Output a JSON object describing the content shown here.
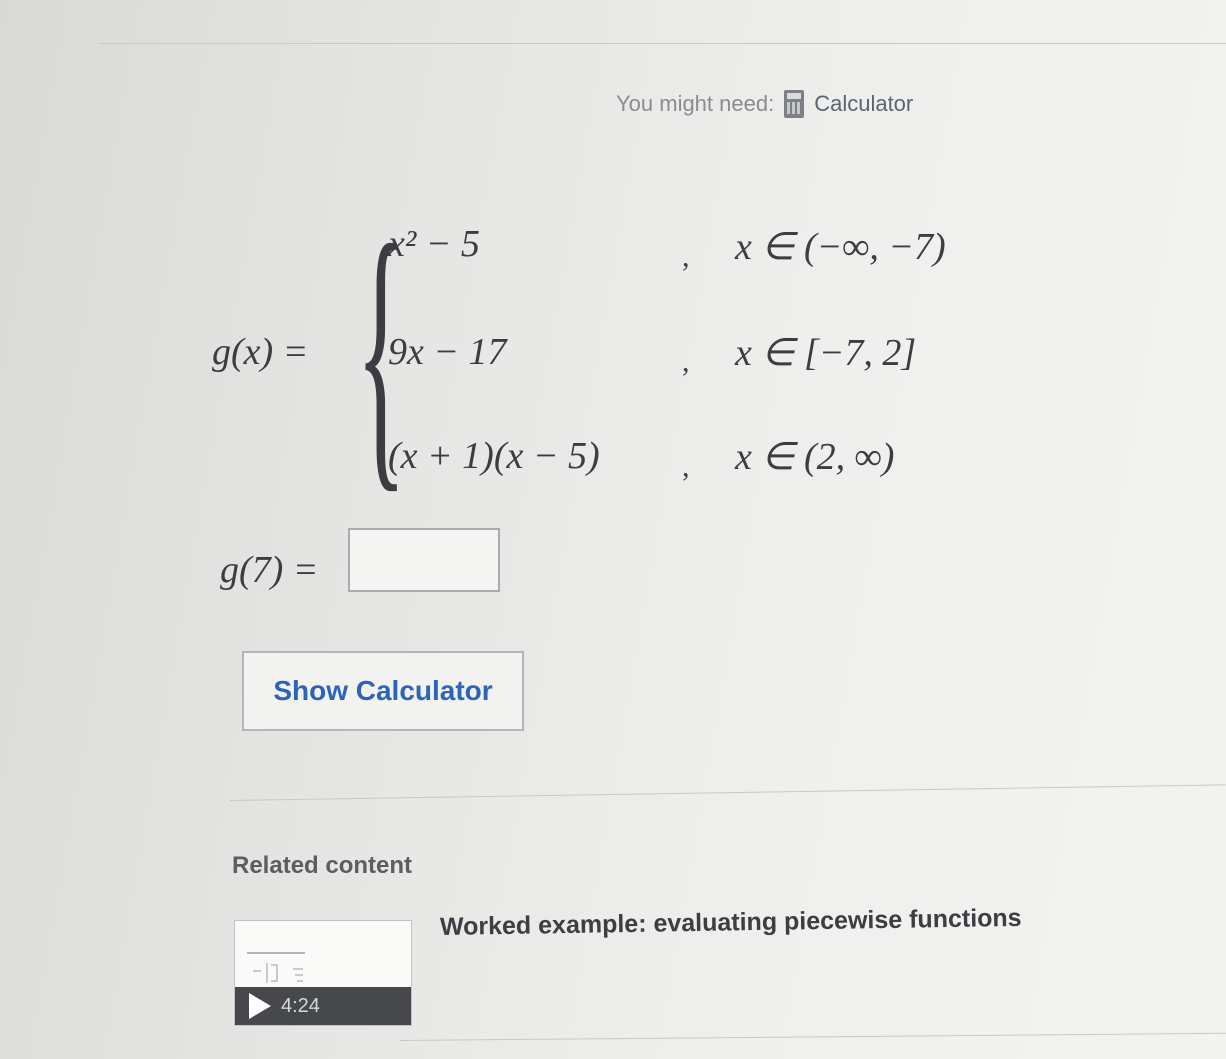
{
  "header": {
    "you_might_need": "You might need:",
    "calculator_link": "Calculator"
  },
  "problem": {
    "function_lhs": "g(x) =",
    "cases": [
      {
        "expr": "x² − 5",
        "domain": "x ∈ (−∞, −7)"
      },
      {
        "expr": "9x − 17",
        "domain": "x ∈ [−7, 2]"
      },
      {
        "expr": "(x + 1)(x − 5)",
        "domain": "x ∈ (2, ∞)"
      }
    ],
    "case_separator": ",",
    "question_lhs": "g(7) =",
    "answer_value": ""
  },
  "show_calculator_button": "Show Calculator",
  "related": {
    "heading": "Related content",
    "video_duration": "4:24",
    "video_title": "Worked example: evaluating piecewise functions"
  },
  "colors": {
    "link_blue": "#2d64b6",
    "text_dark": "#21242c"
  },
  "icons": [
    "calculator-icon",
    "play-icon"
  ]
}
